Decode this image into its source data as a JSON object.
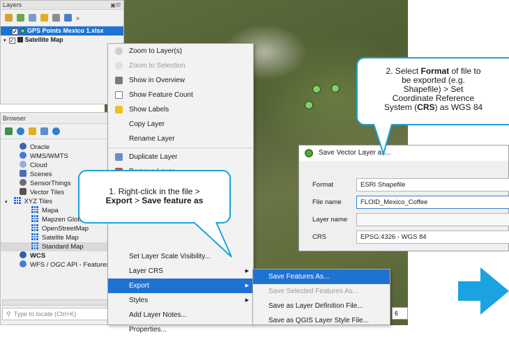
{
  "layers_panel": {
    "title": "Layers",
    "items": [
      {
        "label": "GPS Points Mexico 1.xlsx"
      },
      {
        "label": "Satellite Map"
      }
    ]
  },
  "browser_panel": {
    "title": "Browser",
    "items": [
      {
        "label": "Oracle"
      },
      {
        "label": "WMS/WMTS"
      },
      {
        "label": "Cloud"
      },
      {
        "label": "Scenes"
      },
      {
        "label": "SensorThings"
      },
      {
        "label": "Vector Tiles"
      },
      {
        "label": "XYZ Tiles"
      },
      {
        "label": "Mapa"
      },
      {
        "label": "Mapzen Global Terrain"
      },
      {
        "label": "OpenStreetMap"
      },
      {
        "label": "Satelite Map"
      },
      {
        "label": "Standard Map"
      },
      {
        "label": "WCS"
      },
      {
        "label": "WFS / OGC API - Features"
      }
    ],
    "locate_placeholder": "Type to locate (Ctrl+K)"
  },
  "context_menu": {
    "items": [
      {
        "label": "Zoom to Layer(s)"
      },
      {
        "label": "Zoom to Selection"
      },
      {
        "label": "Show in Overview"
      },
      {
        "label": "Show Feature Count"
      },
      {
        "label": "Show Labels"
      },
      {
        "label": "Copy Layer"
      },
      {
        "label": "Rename Layer"
      },
      {
        "label": "Duplicate Layer"
      },
      {
        "label": "Remove Layer..."
      },
      {
        "label": "Set Layer Scale Visibility..."
      },
      {
        "label": "Layer CRS"
      },
      {
        "label": "Export"
      },
      {
        "label": "Styles"
      },
      {
        "label": "Add Layer Notes..."
      },
      {
        "label": "Properties..."
      }
    ]
  },
  "export_submenu": {
    "items": [
      {
        "label": "Save Features As..."
      },
      {
        "label": "Save Selected Features As..."
      },
      {
        "label": "Save as Layer Definition File..."
      },
      {
        "label": "Save as QGIS Layer Style File..."
      }
    ]
  },
  "save_dialog": {
    "title": "Save Vector Layer as...",
    "format_label": "Format",
    "format_value": "ESRI Shapefile",
    "filename_label": "File name",
    "filename_value": "FLOID_Mexico_Coffee",
    "layername_label": "Layer name",
    "layername_value": "",
    "crs_label": "CRS",
    "crs_value": "EPSG:4326 - WGS 84"
  },
  "callout_1": {
    "line1": "1. Right-click in the file >",
    "export": "Export",
    "gt": " > ",
    "save": "Save feature as"
  },
  "callout_2": {
    "l1": "2. Select ",
    "format": "Format",
    "l1b": " of file to",
    "l2": "be exported (e.g.",
    "l3": "Shapefile) > Set",
    "l4": "Coordinate Reference",
    "l5a": "System (",
    "crs": "CRS",
    "l5b": ") as WGS 84"
  },
  "canvas_extra": {
    "scale_fragment": "6"
  },
  "colors": {
    "accent": "#1e73d2",
    "callout_border": "#1aa3d8",
    "arrow": "#1aa3e0"
  }
}
